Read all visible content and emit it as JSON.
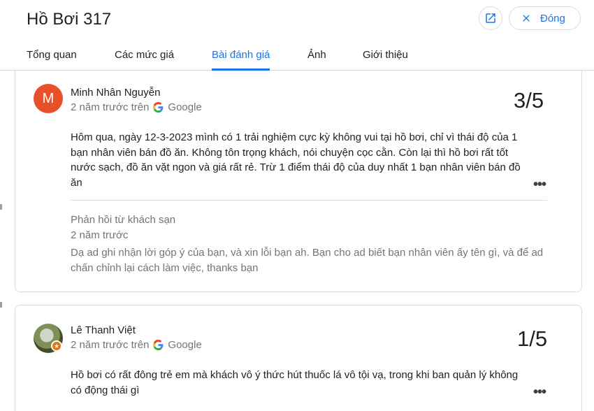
{
  "header": {
    "title": "Hồ Bơi 317",
    "close_label": "Đóng"
  },
  "tabs": [
    "Tổng quan",
    "Các mức giá",
    "Bài đánh giá",
    "Ảnh",
    "Giới thiệu"
  ],
  "reviews": [
    {
      "avatar_letter": "M",
      "author": "Minh Nhân Nguyễn",
      "time": "2 năm trước trên",
      "source": "Google",
      "rating": "3/5",
      "text": "Hôm qua, ngày 12-3-2023 mình có 1 trải nghiệm cực kỳ không vui tại hồ bơi, chỉ vì thái độ của 1 bạn nhân viên bán đồ ăn. Không tôn trọng khách, nói chuyện cọc cằn. Còn lại thì hồ bơi rất tốt nước sạch, đồ ăn vặt ngon và giá rất rẻ. Trừ 1 điểm thái độ của duy nhất 1 bạn nhân viên bán đồ ăn",
      "more": "•••",
      "reply": {
        "label": "Phản hồi từ khách sạn",
        "date": "2 năm trước",
        "text": "Dạ ad ghi nhận lời góp ý của bạn, và xin lỗi bạn ah. Bạn cho ad biết bạn nhân viên ấy tên gì, và để ad chấn chỉnh lại cách làm việc, thanks bạn"
      }
    },
    {
      "author": "Lê Thanh Việt",
      "time": "2 năm trước trên",
      "source": "Google",
      "rating": "1/5",
      "text": "Hồ bơi có rất đông trẻ em mà khách vô ý thức hút thuốc lá vô tội vạ, trong khi ban quản lý không có động thái gì",
      "more": "•••"
    }
  ],
  "colors": {
    "accent": "#1a73e8",
    "avatar_orange": "#e8502a",
    "secondary_text": "#70757a"
  },
  "icons": [
    "open-in-new-icon",
    "close-icon",
    "google-logo-icon",
    "more-horiz-icon",
    "local-guide-badge-icon"
  ]
}
